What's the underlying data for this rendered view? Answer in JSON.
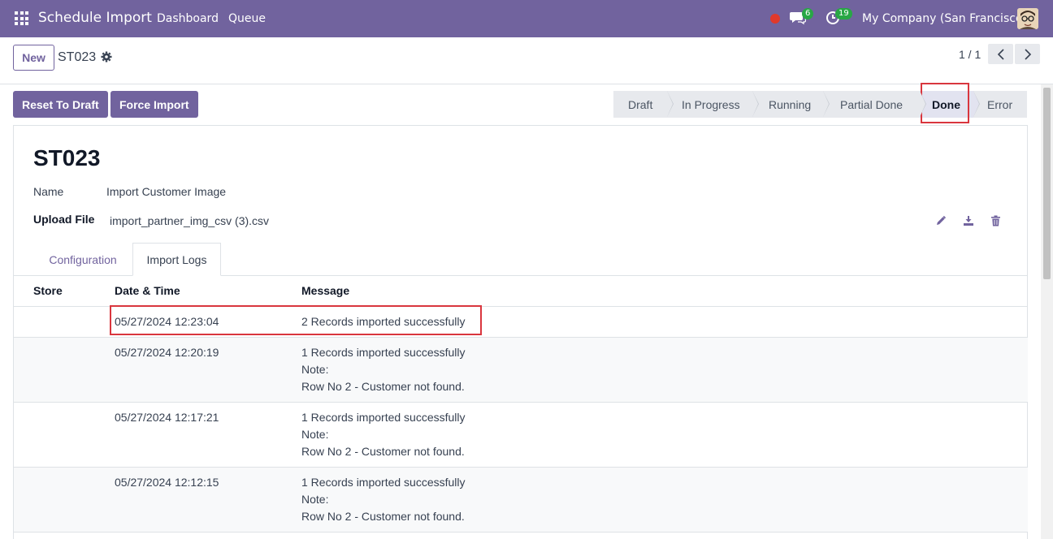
{
  "navbar": {
    "app_title": "Schedule Import",
    "menu": [
      "Dashboard",
      "Queue"
    ],
    "chat_count": "6",
    "activity_count": "19",
    "company": "My Company (San Francisco)"
  },
  "control": {
    "new_label": "New",
    "breadcrumb": "ST023",
    "pager": "1 / 1"
  },
  "actions": {
    "reset_label": "Reset To Draft",
    "force_label": "Force Import"
  },
  "stages": [
    "Draft",
    "In Progress",
    "Running",
    "Partial Done",
    "Done",
    "Error"
  ],
  "active_stage": "Done",
  "record": {
    "title": "ST023",
    "name_label": "Name",
    "name_value": "Import Customer Image",
    "upload_label": "Upload File",
    "upload_value": "import_partner_img_csv (3).csv"
  },
  "tabs": [
    "Configuration",
    "Import Logs"
  ],
  "active_tab": "Import Logs",
  "table": {
    "headers": [
      "Store",
      "Date & Time",
      "Message"
    ],
    "rows": [
      {
        "store": "",
        "datetime": "05/27/2024 12:23:04",
        "message": [
          "2 Records imported successfully"
        ]
      },
      {
        "store": "",
        "datetime": "05/27/2024 12:20:19",
        "message": [
          "1 Records imported successfully",
          "Note:",
          "Row No 2  - Customer not found."
        ]
      },
      {
        "store": "",
        "datetime": "05/27/2024 12:17:21",
        "message": [
          "1 Records imported successfully",
          "Note:",
          "Row No 2  - Customer not found."
        ]
      },
      {
        "store": "",
        "datetime": "05/27/2024 12:12:15",
        "message": [
          "1 Records imported successfully",
          "Note:",
          "Row No 2  - Customer not found."
        ]
      }
    ]
  },
  "colors": {
    "brand": "#71639e",
    "highlight": "#d9363e",
    "badge": "#28a745"
  }
}
